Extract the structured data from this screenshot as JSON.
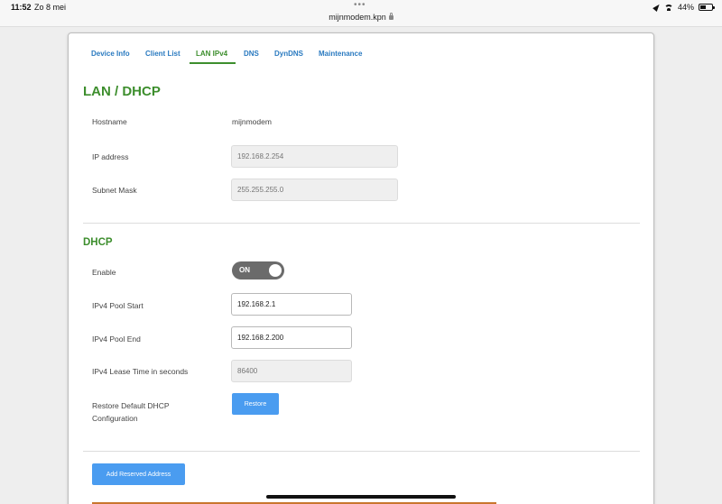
{
  "status_bar": {
    "time": "11:52",
    "date": "Zo 8 mei",
    "url": "mijnmodem.kpn",
    "battery": "44%"
  },
  "tabs": [
    {
      "label": "Device Info"
    },
    {
      "label": "Client List"
    },
    {
      "label": "LAN IPv4",
      "active": true
    },
    {
      "label": "DNS"
    },
    {
      "label": "DynDNS"
    },
    {
      "label": "Maintenance"
    }
  ],
  "lan": {
    "title": "LAN / DHCP",
    "hostname_label": "Hostname",
    "hostname_value": "mijnmodem",
    "ip_label": "IP address",
    "ip_placeholder": "192.168.2.254",
    "mask_label": "Subnet Mask",
    "mask_placeholder": "255.255.255.0"
  },
  "dhcp": {
    "title": "DHCP",
    "enable_label": "Enable",
    "toggle_state": "ON",
    "pool_start_label": "IPv4 Pool Start",
    "pool_start_value": "192.168.2.1",
    "pool_end_label": "IPv4 Pool End",
    "pool_end_value": "192.168.2.200",
    "lease_label": "IPv4 Lease Time in seconds",
    "lease_placeholder": "86400",
    "restore_label_line1": "Restore Default DHCP",
    "restore_label_line2": "Configuration",
    "restore_button": "Restore"
  },
  "reserved": {
    "add_button": "Add Reserved Address"
  },
  "colors": {
    "accent_green": "#3d8e2d",
    "tab_blue": "#2a7ac0",
    "button_blue": "#4a9cf0"
  }
}
